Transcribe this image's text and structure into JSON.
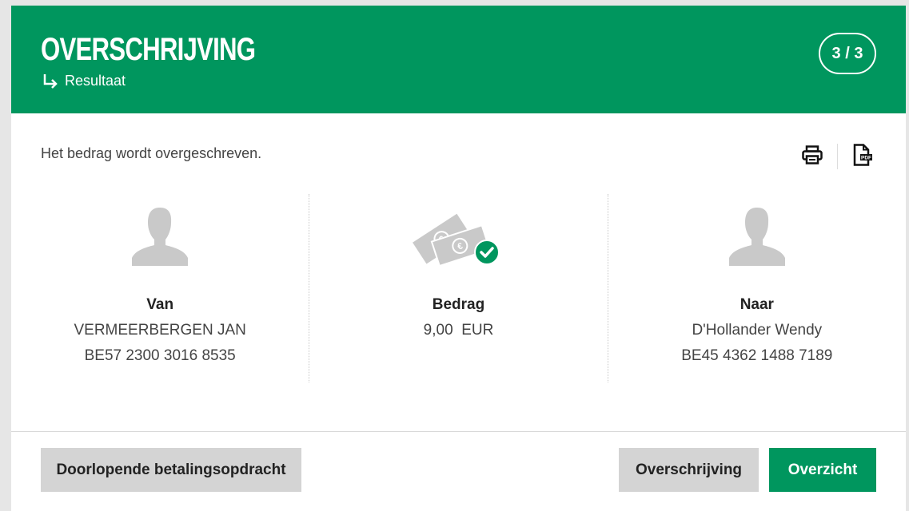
{
  "header": {
    "title": "OVERSCHRIJVING",
    "subtitle": "Resultaat",
    "step": "3 / 3"
  },
  "message": "Het bedrag wordt overgeschreven.",
  "tools": {
    "print_icon": "printer-icon",
    "pdf_icon": "pdf-icon",
    "pdf_text": "PDF"
  },
  "from": {
    "label": "Van",
    "name": "VERMEERBERGEN JAN",
    "account": "BE57 2300 3016 8535"
  },
  "amount": {
    "label": "Bedrag",
    "value": "9,00  EUR"
  },
  "to": {
    "label": "Naar",
    "name": "D'Hollander Wendy",
    "account": "BE45 4362 1488 7189"
  },
  "buttons": {
    "standing_order": "Doorlopende betalingsopdracht",
    "transfer": "Overschrijving",
    "overview": "Overzicht"
  },
  "colors": {
    "brand_green": "#00965e",
    "button_grey": "#d4d4d4"
  }
}
